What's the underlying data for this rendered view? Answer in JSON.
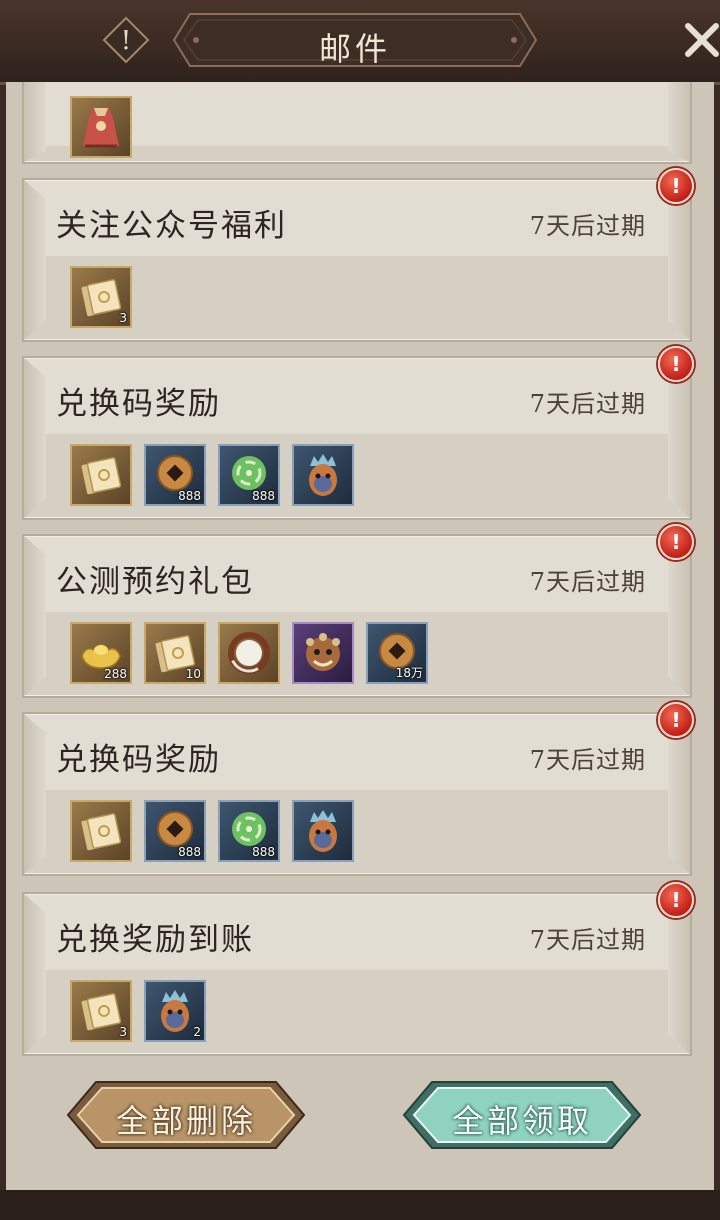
{
  "header": {
    "title": "邮件",
    "info_symbol": "!",
    "close_symbol": "✕"
  },
  "mails": [
    {
      "title": "",
      "expire": "",
      "unread": false,
      "items": [
        {
          "icon": "costume-icon",
          "frame": "gold",
          "qty": ""
        }
      ]
    },
    {
      "title": "关注公众号福利",
      "expire": "7天后过期",
      "unread": true,
      "items": [
        {
          "icon": "ticket-icon",
          "frame": "gold",
          "qty": "3"
        }
      ]
    },
    {
      "title": "兑换码奖励",
      "expire": "7天后过期",
      "unread": true,
      "items": [
        {
          "icon": "ticket-icon",
          "frame": "gold",
          "qty": ""
        },
        {
          "icon": "coin-icon",
          "frame": "blue",
          "qty": "888"
        },
        {
          "icon": "jade-orb-icon",
          "frame": "blue",
          "qty": "888"
        },
        {
          "icon": "mask-icon",
          "frame": "blue",
          "qty": ""
        }
      ]
    },
    {
      "title": "公测预约礼包",
      "expire": "7天后过期",
      "unread": true,
      "items": [
        {
          "icon": "gold-ingot-icon",
          "frame": "gold",
          "qty": "288"
        },
        {
          "icon": "ticket-icon",
          "frame": "gold",
          "qty": "10"
        },
        {
          "icon": "ring-icon",
          "frame": "gold",
          "qty": ""
        },
        {
          "icon": "lion-head-icon",
          "frame": "purple",
          "qty": ""
        },
        {
          "icon": "coin-icon",
          "frame": "blue",
          "qty": "18万"
        }
      ]
    },
    {
      "title": "兑换码奖励",
      "expire": "7天后过期",
      "unread": true,
      "items": [
        {
          "icon": "ticket-icon",
          "frame": "gold",
          "qty": ""
        },
        {
          "icon": "coin-icon",
          "frame": "blue",
          "qty": "888"
        },
        {
          "icon": "jade-orb-icon",
          "frame": "blue",
          "qty": "888"
        },
        {
          "icon": "mask-icon",
          "frame": "blue",
          "qty": ""
        }
      ]
    },
    {
      "title": "兑换奖励到账",
      "expire": "7天后过期",
      "unread": true,
      "items": [
        {
          "icon": "ticket-icon",
          "frame": "gold",
          "qty": "3"
        },
        {
          "icon": "mask-icon",
          "frame": "blue",
          "qty": "2"
        }
      ]
    }
  ],
  "buttons": {
    "delete_all": "全部删除",
    "claim_all": "全部领取"
  },
  "badge_symbol": "!"
}
